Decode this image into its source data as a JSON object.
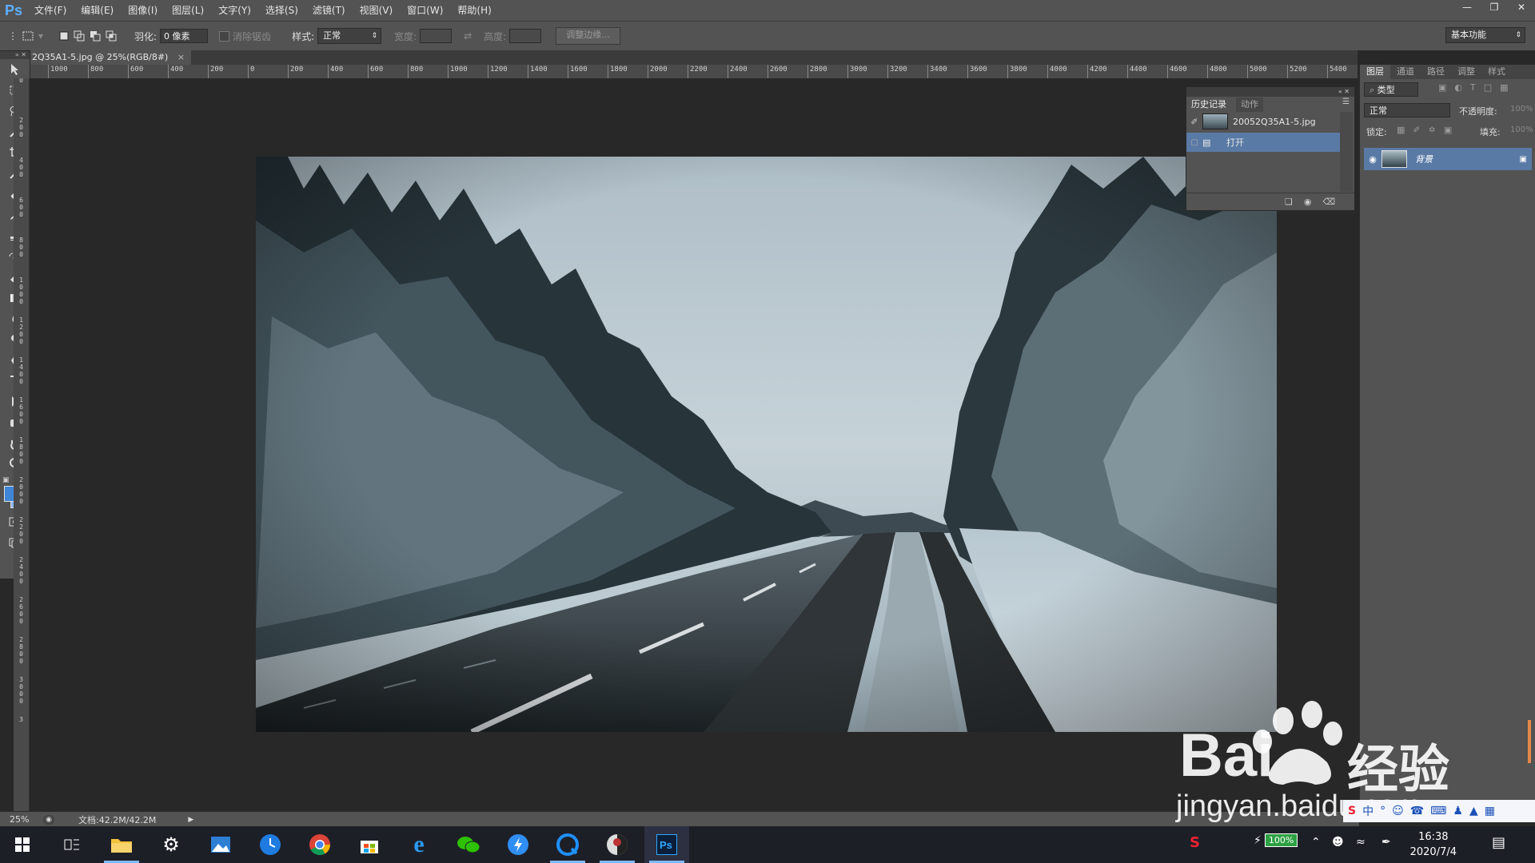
{
  "app": {
    "logo": "Ps",
    "menu": [
      "文件(F)",
      "编辑(E)",
      "图像(I)",
      "图层(L)",
      "文字(Y)",
      "选择(S)",
      "滤镜(T)",
      "视图(V)",
      "窗口(W)",
      "帮助(H)"
    ]
  },
  "options": {
    "feather_label": "羽化:",
    "feather_value": "0 像素",
    "antialias_label": "消除锯齿",
    "style_label": "样式:",
    "style_value": "正常",
    "width_label": "宽度:",
    "height_label": "高度:",
    "refine_edge": "调整边缘...",
    "workspace": "基本功能"
  },
  "document": {
    "tab_title": "2Q35A1-5.jpg @ 25%(RGB/8#)",
    "zoom": "25%",
    "doc_size": "文档:42.2M/42.2M"
  },
  "ruler": {
    "h_ticks": [
      "1000",
      "800",
      "600",
      "400",
      "200",
      "0",
      "200",
      "400",
      "600",
      "800",
      "1000",
      "1200",
      "1400",
      "1600",
      "1800",
      "2000",
      "2200",
      "2400",
      "2600",
      "2800",
      "3000",
      "3200",
      "3400",
      "3600",
      "3800",
      "4000",
      "4200",
      "4400",
      "4600",
      "4800",
      "5000",
      "5200",
      "5400"
    ],
    "v_ticks": [
      "0",
      "2 0 0",
      "4 0 0",
      "6 0 0",
      "8 0 0",
      "1 0 0 0",
      "1 2 0 0",
      "1 4 0 0",
      "1 6 0 0",
      "1 8 0 0",
      "2 0 0 0",
      "2 2 0 0",
      "2 4 0 0",
      "2 6 0 0",
      "2 8 0 0",
      "3 0 0 0",
      "3"
    ]
  },
  "history_panel": {
    "tabs": [
      "历史记录",
      "动作"
    ],
    "snapshot": "20052Q35A1-5.jpg",
    "step": "打开"
  },
  "layers_panel": {
    "tabs": [
      "图层",
      "通道",
      "路径",
      "调整",
      "样式"
    ],
    "filter": "类型",
    "blend_mode": "正常",
    "opacity_label": "不透明度:",
    "opacity_value": "100%",
    "lock_label": "锁定:",
    "fill_label": "填充:",
    "fill_value": "100%",
    "layer_name": "背景"
  },
  "taskbar": {
    "battery": "100%",
    "time": "16:38",
    "date": "2020/7/4"
  },
  "watermark": {
    "brand": "Bai",
    "brand2": "经验",
    "url": "jingyan.baidu.com"
  },
  "colors": {
    "accent": "#5a7aa6",
    "ps_blue": "#5db0ff",
    "panel": "#535353",
    "canvas_bg": "#282828"
  }
}
